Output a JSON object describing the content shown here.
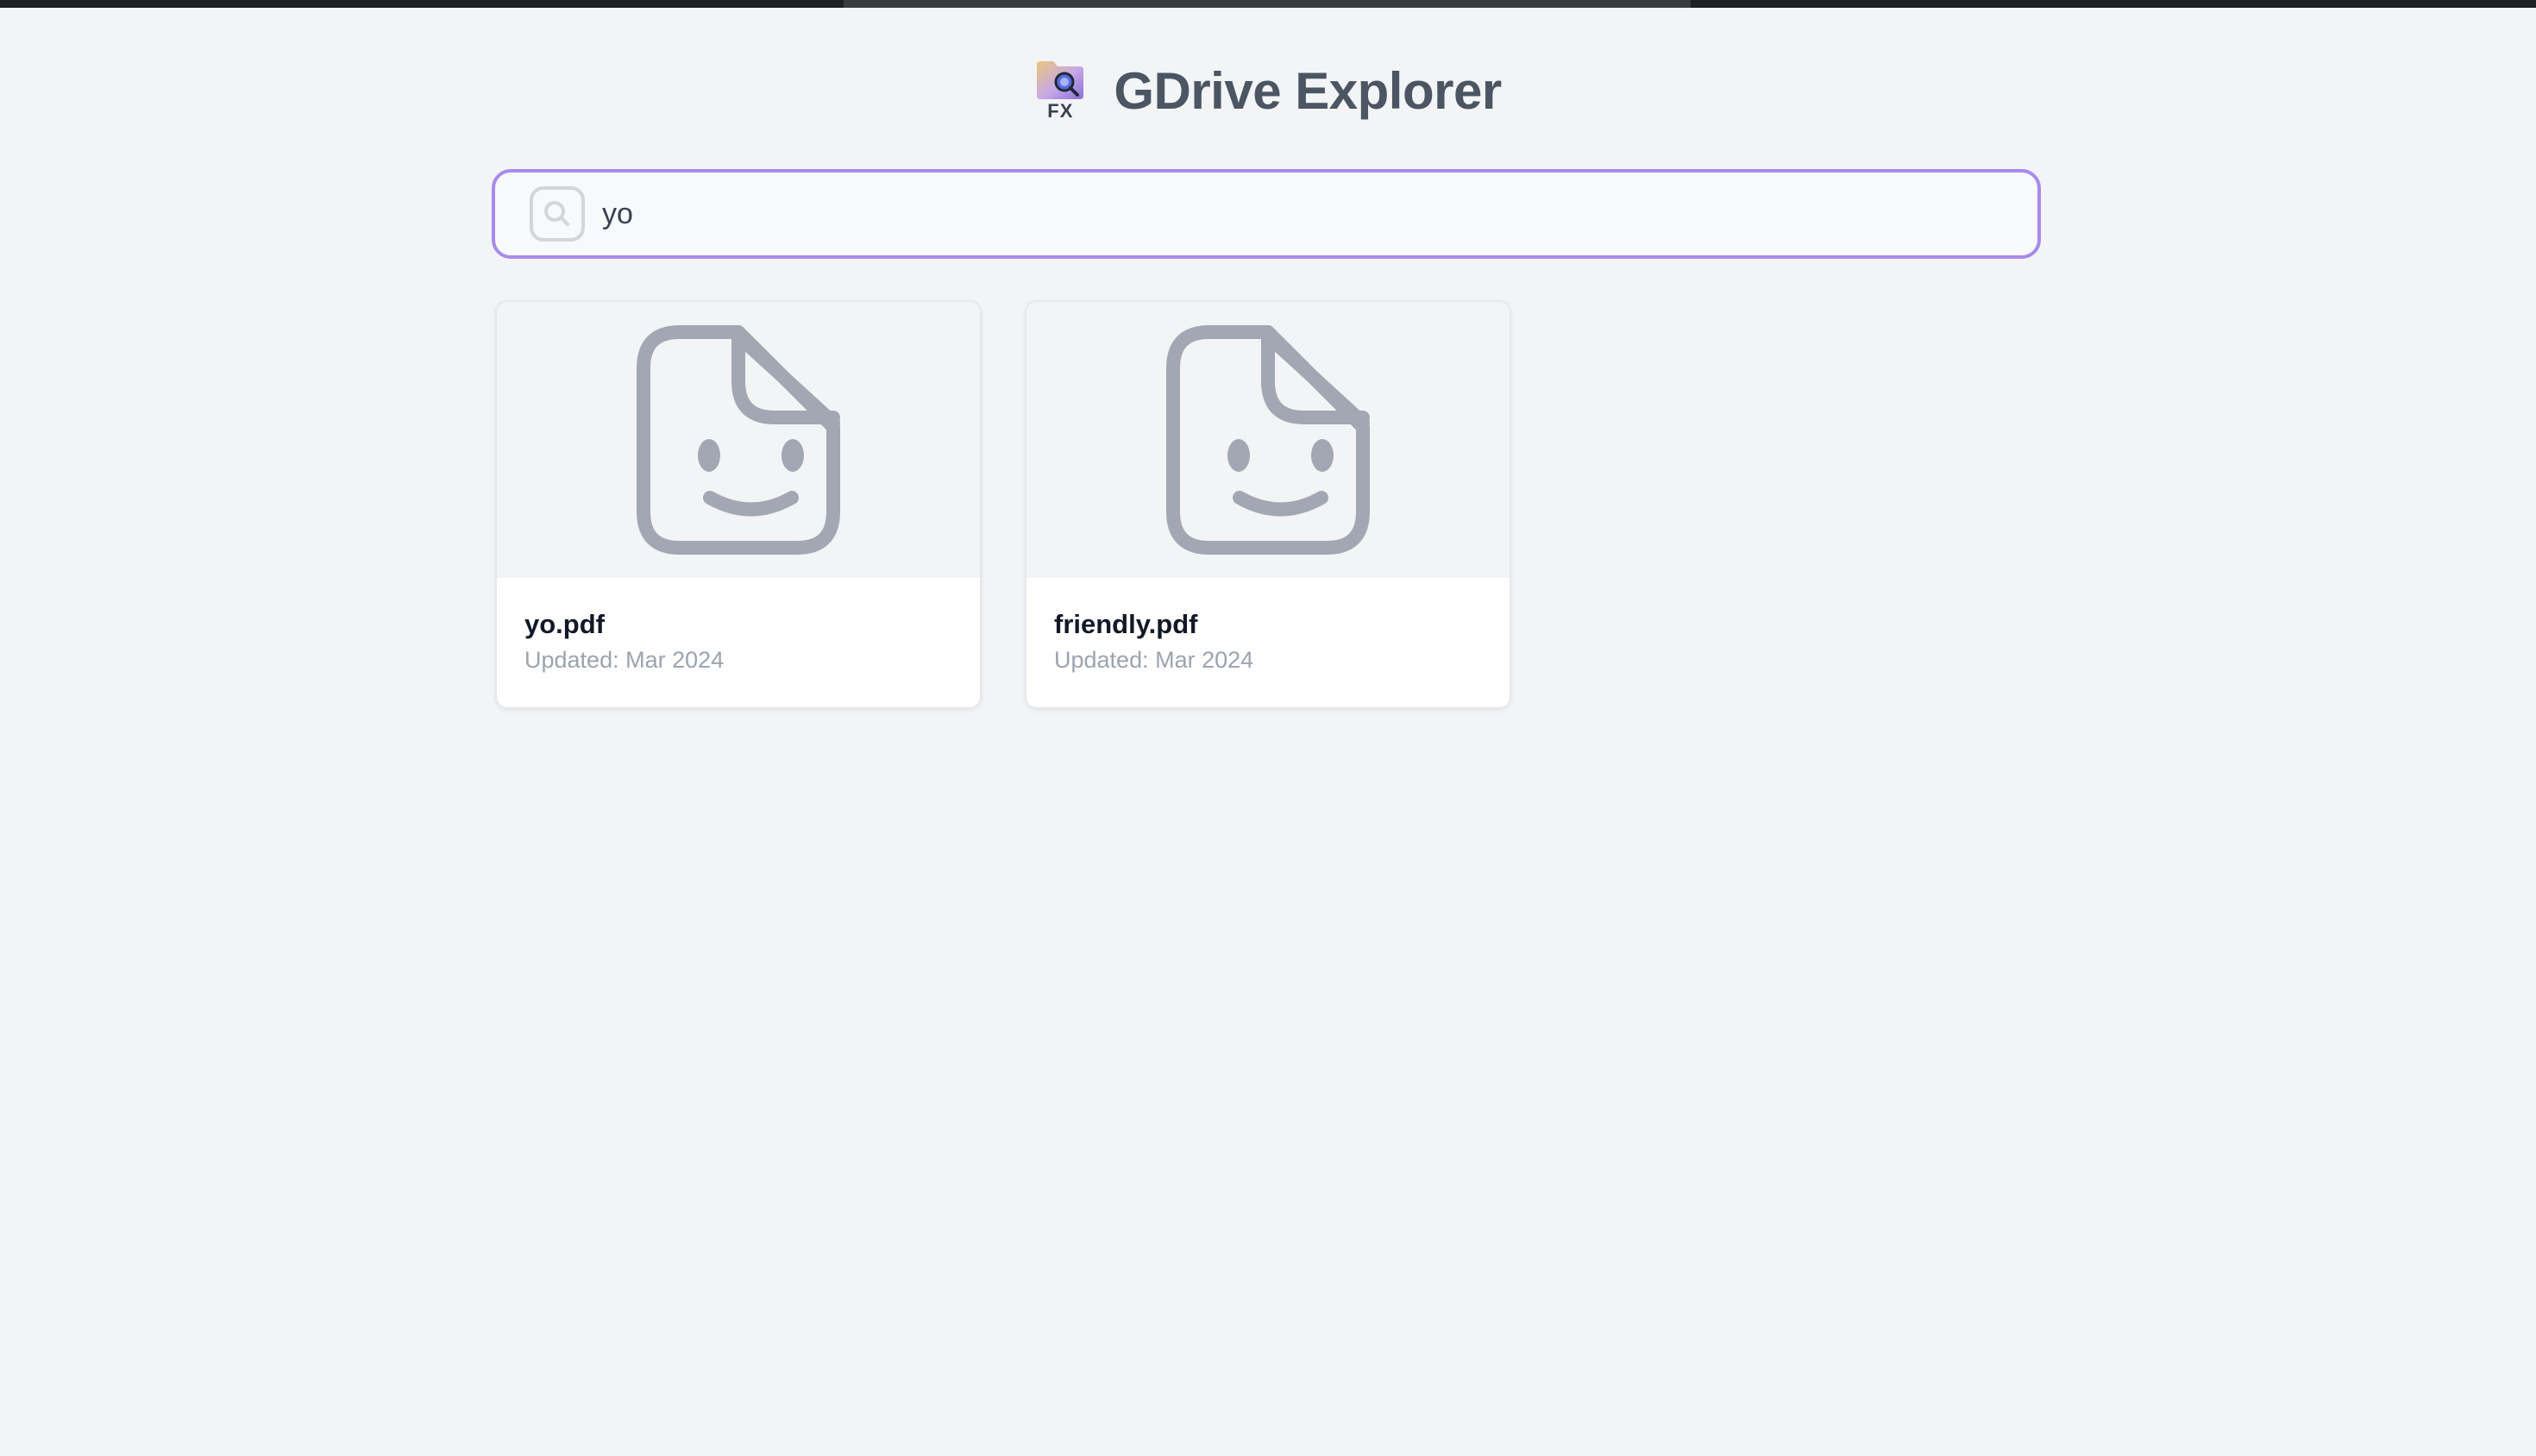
{
  "app": {
    "title": "GDrive Explorer",
    "logo_label": "FX",
    "logo_icon": "folder-search-icon"
  },
  "search": {
    "value": "yo",
    "placeholder": "",
    "icon": "search-icon"
  },
  "results": [
    {
      "name": "yo.pdf",
      "updated": "Updated: Mar 2024",
      "icon": "file-smile-icon"
    },
    {
      "name": "friendly.pdf",
      "updated": "Updated: Mar 2024",
      "icon": "file-smile-icon"
    }
  ],
  "colors": {
    "background": "#f3f4f6",
    "accent": "#a78bea",
    "icon_gray": "#a3a7b3",
    "title": "#4b5563"
  }
}
